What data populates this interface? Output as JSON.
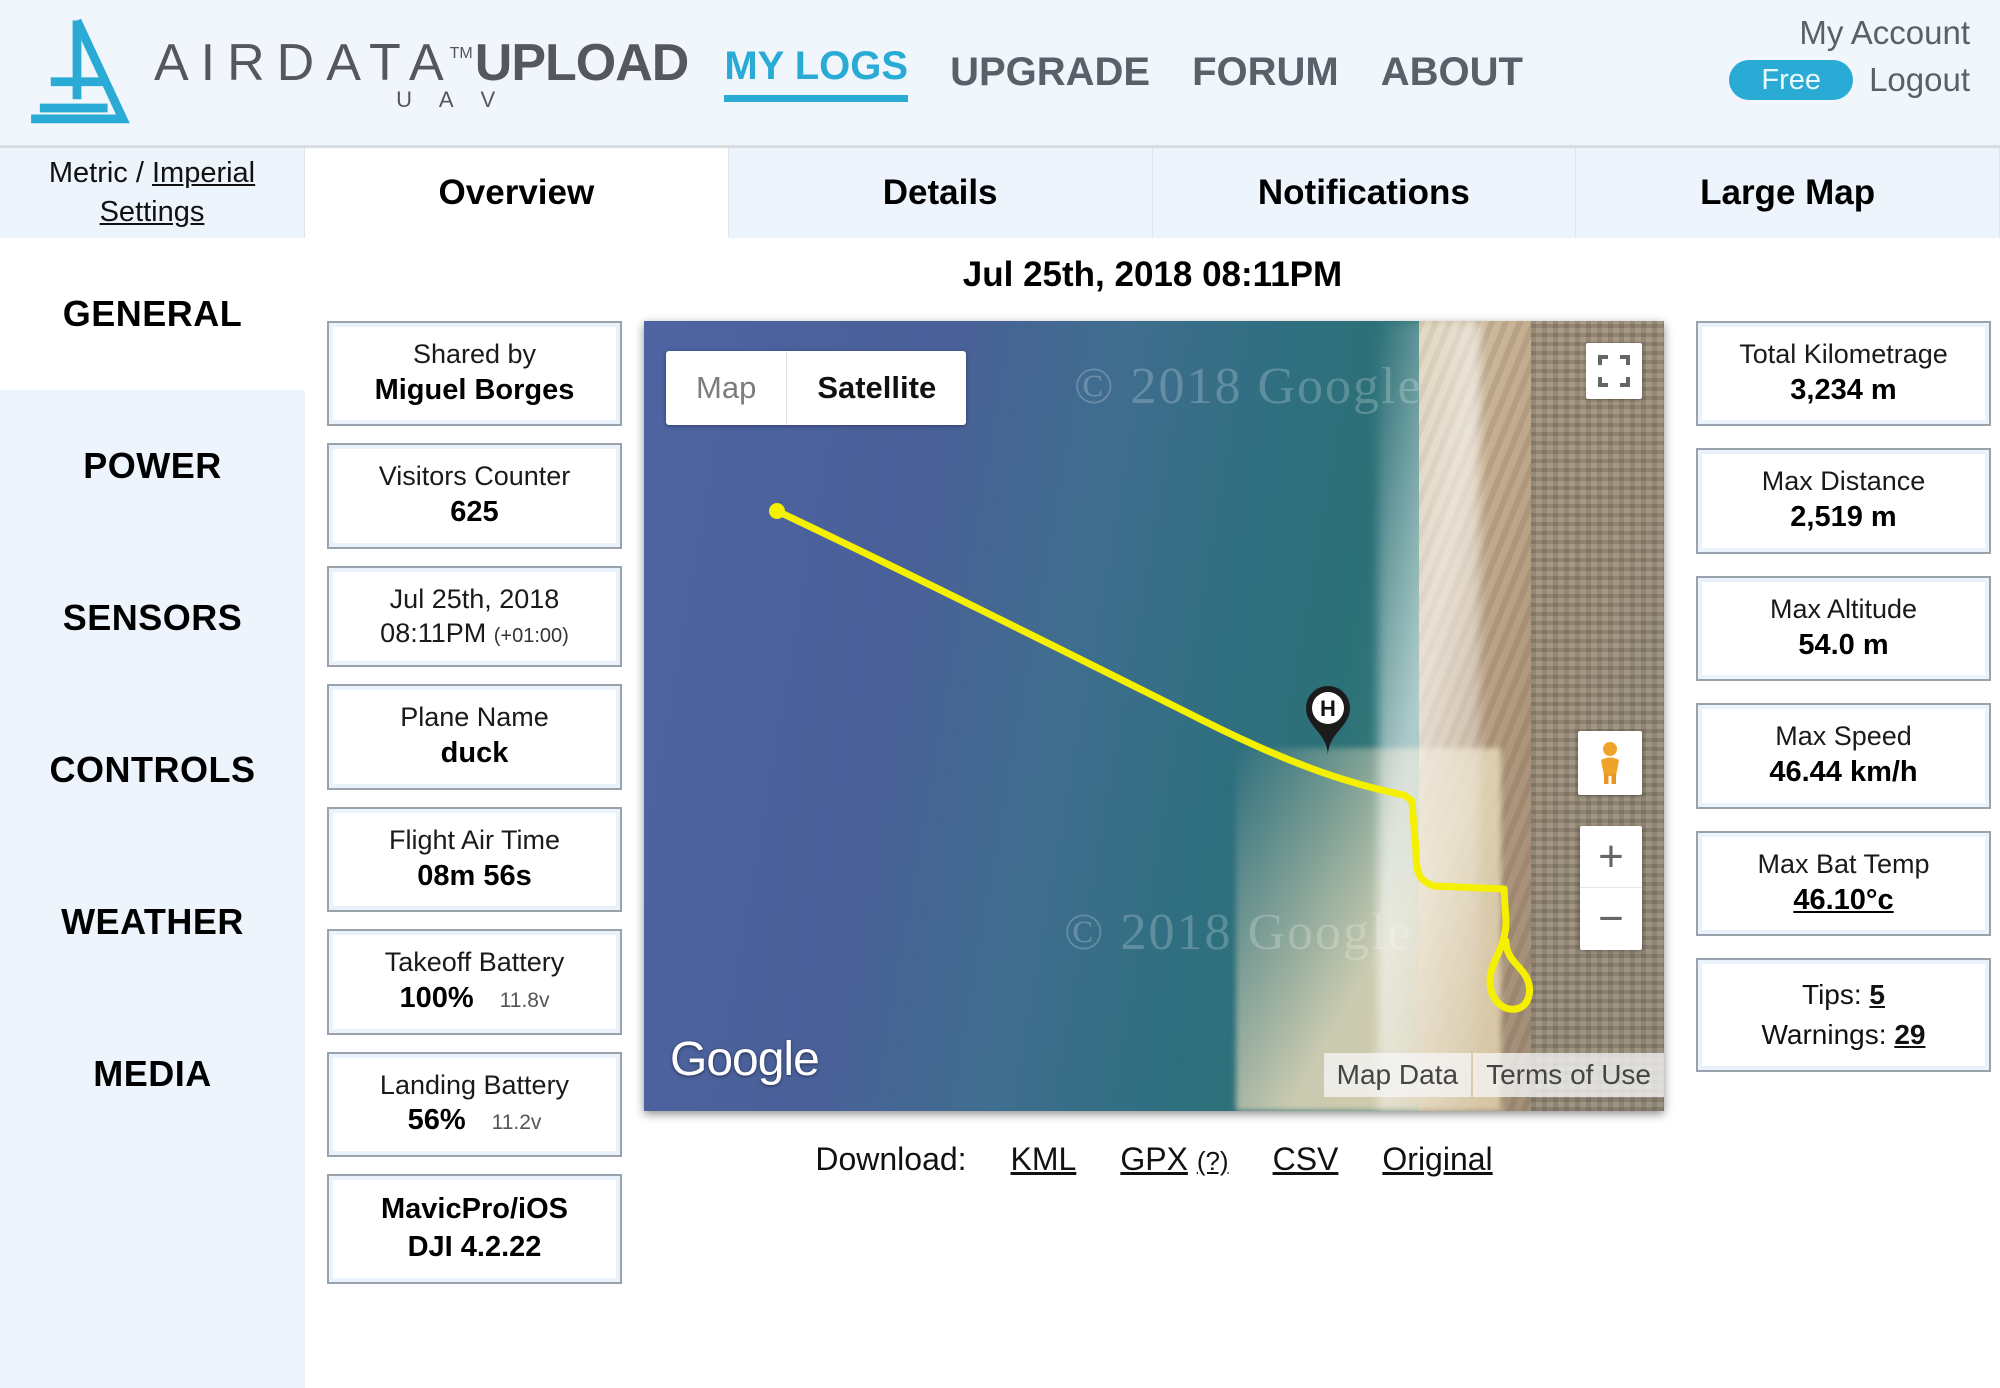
{
  "header": {
    "logo": {
      "brand": "AIRDATA",
      "tm": "TM",
      "product": "UPLOAD",
      "sub": "U A V"
    },
    "nav": [
      {
        "label": "MY LOGS",
        "active": true
      },
      {
        "label": "UPGRADE",
        "active": false
      },
      {
        "label": "FORUM",
        "active": false
      },
      {
        "label": "ABOUT",
        "active": false
      }
    ],
    "account": {
      "title": "My Account",
      "plan_badge": "Free",
      "logout": "Logout"
    },
    "accent_color": "#29abd6",
    "text_color": "#58606a"
  },
  "units": {
    "metric_label": "Metric",
    "separator": " / ",
    "imperial_label": "Imperial",
    "settings_label": "Settings"
  },
  "tabs": [
    {
      "label": "Overview",
      "active": true
    },
    {
      "label": "Details",
      "active": false
    },
    {
      "label": "Notifications",
      "active": false
    },
    {
      "label": "Large Map",
      "active": false
    }
  ],
  "sidebar": {
    "items": [
      {
        "label": "GENERAL",
        "active": true
      },
      {
        "label": "POWER",
        "active": false
      },
      {
        "label": "SENSORS",
        "active": false
      },
      {
        "label": "CONTROLS",
        "active": false
      },
      {
        "label": "WEATHER",
        "active": false
      },
      {
        "label": "MEDIA",
        "active": false
      }
    ]
  },
  "flight": {
    "date_title": "Jul 25th, 2018 08:11PM"
  },
  "info_cards": [
    {
      "label": "Shared by",
      "value": "Miguel Borges"
    },
    {
      "label": "Visitors Counter",
      "value": "625"
    },
    {
      "label": "Jul 25th, 2018",
      "value": "08:11PM",
      "note": "(+01:00)"
    },
    {
      "label": "Plane Name",
      "value": "duck"
    },
    {
      "label": "Flight Air Time",
      "value": "08m 56s"
    },
    {
      "label": "Takeoff Battery",
      "value": "100%",
      "sub": "11.8v"
    },
    {
      "label": "Landing Battery",
      "value": "56%",
      "sub": "11.2v"
    },
    {
      "label": "MavicPro/iOS",
      "value": "DJI 4.2.22"
    }
  ],
  "stat_cards": [
    {
      "label": "Total Kilometrage",
      "value": "3,234 m"
    },
    {
      "label": "Max Distance",
      "value": "2,519 m"
    },
    {
      "label": "Max Altitude",
      "value": "54.0 m"
    },
    {
      "label": "Max Speed",
      "value": "46.44 km/h"
    },
    {
      "label": "Max Bat Temp",
      "value": "46.10°c",
      "underlined": true
    }
  ],
  "tips_card": {
    "tips_label": "Tips:",
    "tips_value": "5",
    "warnings_label": "Warnings:",
    "warnings_value": "29"
  },
  "map": {
    "type_map": "Map",
    "type_satellite": "Satellite",
    "selected_type": "Satellite",
    "provider_logo": "Google",
    "watermark": "© 2018 Google",
    "zoom_in": "+",
    "zoom_out": "−",
    "home_marker_label": "H",
    "attribution": [
      "Map Data",
      "Terms of Use"
    ],
    "track_color": "#f5f000"
  },
  "download": {
    "label": "Download:",
    "links": [
      {
        "label": "KML"
      },
      {
        "label": "GPX",
        "hint": "(?)"
      },
      {
        "label": "CSV"
      },
      {
        "label": "Original"
      }
    ]
  }
}
